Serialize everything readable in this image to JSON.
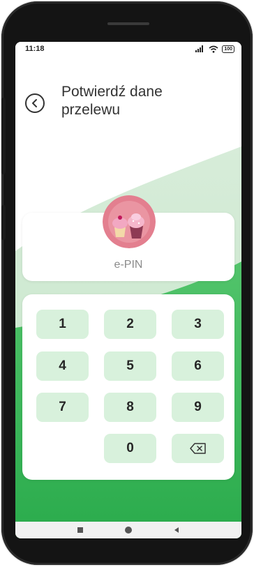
{
  "status_bar": {
    "time": "11:18",
    "battery": "100",
    "signal_icon": "signal-icon",
    "wifi_icon": "wifi-icon"
  },
  "header": {
    "title": "Potwierdź dane przelewu",
    "back_icon": "back-arrow-icon"
  },
  "pin": {
    "label": "e-PIN",
    "avatar_icon": "cupcakes-avatar"
  },
  "keypad": {
    "keys": [
      "1",
      "2",
      "3",
      "4",
      "5",
      "6",
      "7",
      "8",
      "9",
      "0"
    ],
    "backspace_icon": "backspace-icon"
  },
  "navbar": {
    "icons": [
      "recent-apps-icon",
      "home-icon",
      "back-icon"
    ]
  },
  "colors": {
    "accent_green": "#3dbb5c",
    "key_bg": "#d8f1dc",
    "light_green": "#d5ecd7"
  }
}
